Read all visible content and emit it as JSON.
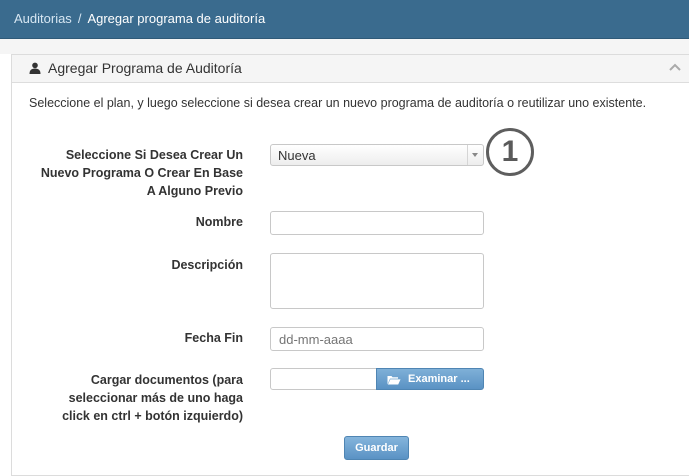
{
  "breadcrumb": {
    "parent": "Auditorias",
    "separator": "/",
    "current": "Agregar programa de auditoría"
  },
  "panel": {
    "title": "Agregar Programa de Auditoría",
    "user_icon": "user-icon",
    "collapse_icon": "chevron-up-icon"
  },
  "intro": "Seleccione el plan, y luego seleccione si desea crear un nuevo programa de auditoría o reutilizar uno existente.",
  "form": {
    "mode": {
      "label_lines": [
        "Seleccione Si Desea Crear Un",
        "Nuevo Programa O Crear En Base",
        "A Alguno Previo"
      ],
      "selected": "Nueva"
    },
    "nombre": {
      "label": "Nombre",
      "value": ""
    },
    "descripcion": {
      "label": "Descripción",
      "value": ""
    },
    "fecha_fin": {
      "label": "Fecha Fin",
      "placeholder": "dd-mm-aaaa"
    },
    "documentos": {
      "label_lines": [
        "Cargar documentos (para",
        "seleccionar más de uno haga",
        "click en ctrl + botón izquierdo)"
      ],
      "value": "",
      "browse_label": "Examinar ..."
    },
    "submit_label": "Guardar"
  },
  "annotation_marker": "1",
  "colors": {
    "topbar": "#3a6b8e",
    "button": "#5a92c4"
  }
}
